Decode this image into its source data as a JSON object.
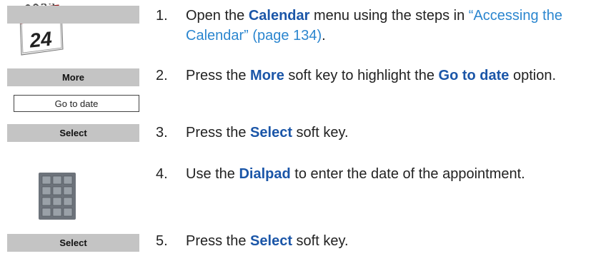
{
  "icons": {
    "calendar_day": "24"
  },
  "softkeys": {
    "more": "More",
    "select_1": "Select",
    "select_2": "Select"
  },
  "menu_option": "Go to date",
  "steps": [
    {
      "num": "1.",
      "parts": [
        {
          "t": "Open the "
        },
        {
          "t": "Calendar",
          "s": "kw"
        },
        {
          "t": " menu using the steps in "
        },
        {
          "t": "“Accessing the Calendar” (page 134)",
          "s": "link"
        },
        {
          "t": "."
        }
      ]
    },
    {
      "num": "2.",
      "parts": [
        {
          "t": "Press the "
        },
        {
          "t": "More",
          "s": "kw"
        },
        {
          "t": " soft key to highlight the "
        },
        {
          "t": "Go to date",
          "s": "kw"
        },
        {
          "t": " option."
        }
      ]
    },
    {
      "num": "3.",
      "parts": [
        {
          "t": "Press the "
        },
        {
          "t": "Select",
          "s": "kw"
        },
        {
          "t": " soft key."
        }
      ]
    },
    {
      "num": "4.",
      "parts": [
        {
          "t": "Use the "
        },
        {
          "t": "Dialpad",
          "s": "kw"
        },
        {
          "t": " to enter the date of the appointment."
        }
      ]
    },
    {
      "num": "5.",
      "parts": [
        {
          "t": "Press the "
        },
        {
          "t": "Select",
          "s": "kw"
        },
        {
          "t": " soft key."
        }
      ]
    }
  ],
  "colors": {
    "keyword": "#1b56a8",
    "link": "#2b86cf",
    "softkey_bg": "#c4c4c4"
  }
}
